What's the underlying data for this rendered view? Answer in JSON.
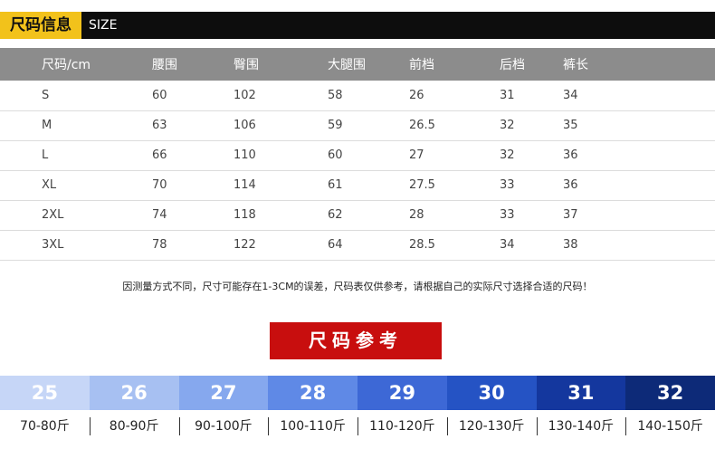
{
  "header": {
    "tag": "尺码信息",
    "sub": "SIZE"
  },
  "table": {
    "columns": [
      "尺码/cm",
      "腰围",
      "臀围",
      "大腿围",
      "前档",
      "后档",
      "裤长"
    ],
    "rows": [
      [
        "S",
        "60",
        "102",
        "58",
        "26",
        "31",
        "34"
      ],
      [
        "M",
        "63",
        "106",
        "59",
        "26.5",
        "32",
        "35"
      ],
      [
        "L",
        "66",
        "110",
        "60",
        "27",
        "32",
        "36"
      ],
      [
        "XL",
        "70",
        "114",
        "61",
        "27.5",
        "33",
        "36"
      ],
      [
        "2XL",
        "74",
        "118",
        "62",
        "28",
        "33",
        "37"
      ],
      [
        "3XL",
        "78",
        "122",
        "64",
        "28.5",
        "34",
        "38"
      ]
    ]
  },
  "note": "因测量方式不同，尺寸可能存在1-3CM的误差，尺码表仅供参考，请根据自己的实际尺寸选择合适的尺码！",
  "reference": {
    "title": "尺码参考",
    "waist_sizes": [
      "25",
      "26",
      "27",
      "28",
      "29",
      "30",
      "31",
      "32"
    ],
    "waist_colors": [
      "#c6d6f7",
      "#a7c0f2",
      "#86a8ee",
      "#5f89e6",
      "#3d68d6",
      "#2553c4",
      "#14379e",
      "#0d2a78"
    ],
    "weights": [
      "70-80斤",
      "80-90斤",
      "90-100斤",
      "100-110斤",
      "110-120斤",
      "120-130斤",
      "130-140斤",
      "140-150斤"
    ]
  }
}
